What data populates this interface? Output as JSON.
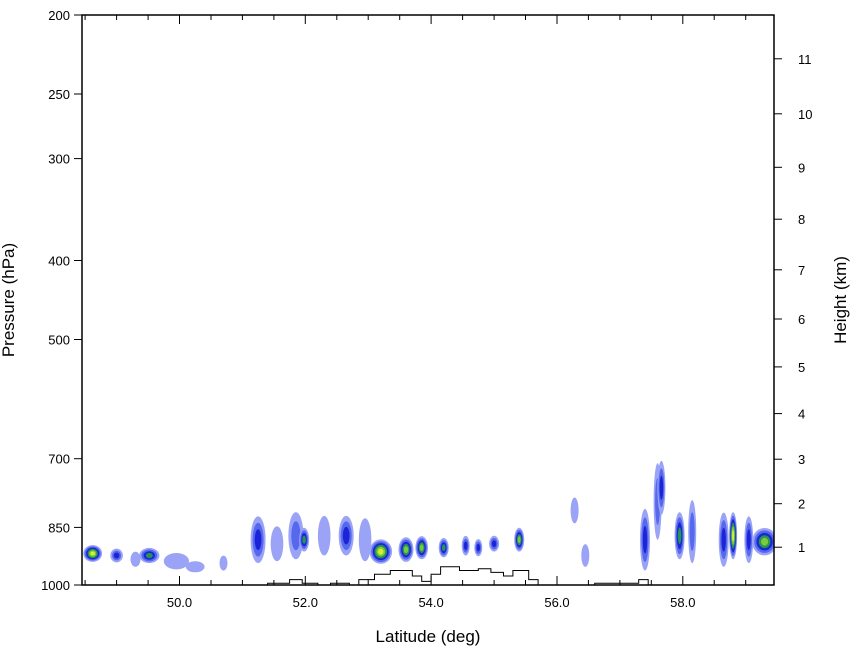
{
  "chart_data": {
    "type": "contour",
    "xlabel": "Latitude (deg)",
    "ylabel_left": "Pressure (hPa)",
    "ylabel_right": "Height (km)",
    "xlim": [
      48.45,
      59.45
    ],
    "x_ticks": [
      {
        "value": 50.0,
        "label": "50.0"
      },
      {
        "value": 52.0,
        "label": "52.0"
      },
      {
        "value": 54.0,
        "label": "54.0"
      },
      {
        "value": 56.0,
        "label": "56.0"
      },
      {
        "value": 58.0,
        "label": "58.0"
      }
    ],
    "pressure_range_hPa": [
      1000,
      200
    ],
    "pressure_ticks": [
      {
        "value": 200,
        "label": "200"
      },
      {
        "value": 250,
        "label": "250"
      },
      {
        "value": 300,
        "label": "300"
      },
      {
        "value": 400,
        "label": "400"
      },
      {
        "value": 500,
        "label": "500"
      },
      {
        "value": 700,
        "label": "700"
      },
      {
        "value": 850,
        "label": "850"
      },
      {
        "value": 1000,
        "label": "1000"
      }
    ],
    "height_ticks": [
      {
        "value": 1,
        "label": "1"
      },
      {
        "value": 2,
        "label": "2"
      },
      {
        "value": 3,
        "label": "3"
      },
      {
        "value": 4,
        "label": "4"
      },
      {
        "value": 5,
        "label": "5"
      },
      {
        "value": 6,
        "label": "6"
      },
      {
        "value": 7,
        "label": "7"
      },
      {
        "value": 8,
        "label": "8"
      },
      {
        "value": 9,
        "label": "9"
      },
      {
        "value": 10,
        "label": "10"
      },
      {
        "value": 11,
        "label": "11"
      }
    ],
    "fill_colors": [
      "#9aa3f5",
      "#5568ee",
      "#1c24d8",
      "#23964f",
      "#7cc93c",
      "#d7f02c"
    ],
    "cells": [
      {
        "lat": 48.62,
        "p": 915,
        "sx": 0.15,
        "sp": 22,
        "level": 6
      },
      {
        "lat": 49.0,
        "p": 920,
        "sx": 0.1,
        "sp": 18,
        "level": 3
      },
      {
        "lat": 49.3,
        "p": 930,
        "sx": 0.08,
        "sp": 20,
        "level": 1
      },
      {
        "lat": 49.52,
        "p": 920,
        "sx": 0.16,
        "sp": 20,
        "level": 4
      },
      {
        "lat": 49.95,
        "p": 935,
        "sx": 0.2,
        "sp": 22,
        "level": 1
      },
      {
        "lat": 50.25,
        "p": 950,
        "sx": 0.15,
        "sp": 15,
        "level": 1
      },
      {
        "lat": 50.7,
        "p": 940,
        "sx": 0.06,
        "sp": 20,
        "level": 1
      },
      {
        "lat": 51.25,
        "p": 880,
        "sx": 0.12,
        "sp": 60,
        "level": 3
      },
      {
        "lat": 51.55,
        "p": 890,
        "sx": 0.1,
        "sp": 45,
        "level": 1
      },
      {
        "lat": 51.85,
        "p": 870,
        "sx": 0.12,
        "sp": 60,
        "level": 2
      },
      {
        "lat": 51.98,
        "p": 880,
        "sx": 0.08,
        "sp": 30,
        "level": 4
      },
      {
        "lat": 52.3,
        "p": 870,
        "sx": 0.1,
        "sp": 50,
        "level": 1
      },
      {
        "lat": 52.65,
        "p": 870,
        "sx": 0.12,
        "sp": 50,
        "level": 3
      },
      {
        "lat": 52.95,
        "p": 880,
        "sx": 0.1,
        "sp": 55,
        "level": 1
      },
      {
        "lat": 53.2,
        "p": 910,
        "sx": 0.18,
        "sp": 32,
        "level": 6
      },
      {
        "lat": 53.6,
        "p": 905,
        "sx": 0.12,
        "sp": 32,
        "level": 5
      },
      {
        "lat": 53.85,
        "p": 900,
        "sx": 0.1,
        "sp": 30,
        "level": 5
      },
      {
        "lat": 54.2,
        "p": 900,
        "sx": 0.08,
        "sp": 25,
        "level": 4
      },
      {
        "lat": 54.55,
        "p": 895,
        "sx": 0.06,
        "sp": 25,
        "level": 3
      },
      {
        "lat": 54.75,
        "p": 900,
        "sx": 0.05,
        "sp": 22,
        "level": 3
      },
      {
        "lat": 55.0,
        "p": 890,
        "sx": 0.08,
        "sp": 20,
        "level": 3
      },
      {
        "lat": 55.4,
        "p": 880,
        "sx": 0.08,
        "sp": 30,
        "level": 5
      },
      {
        "lat": 56.28,
        "p": 810,
        "sx": 0.04,
        "sp": 30,
        "level": 1
      },
      {
        "lat": 56.45,
        "p": 920,
        "sx": 0.04,
        "sp": 30,
        "level": 1
      },
      {
        "lat": 57.4,
        "p": 880,
        "sx": 0.08,
        "sp": 80,
        "level": 3
      },
      {
        "lat": 57.6,
        "p": 790,
        "sx": 0.06,
        "sp": 90,
        "level": 2
      },
      {
        "lat": 57.66,
        "p": 760,
        "sx": 0.05,
        "sp": 60,
        "level": 3
      },
      {
        "lat": 57.95,
        "p": 870,
        "sx": 0.08,
        "sp": 60,
        "level": 4
      },
      {
        "lat": 58.15,
        "p": 860,
        "sx": 0.05,
        "sp": 80,
        "level": 2
      },
      {
        "lat": 58.65,
        "p": 880,
        "sx": 0.08,
        "sp": 70,
        "level": 3
      },
      {
        "lat": 58.8,
        "p": 870,
        "sx": 0.06,
        "sp": 60,
        "level": 6
      },
      {
        "lat": 59.05,
        "p": 880,
        "sx": 0.07,
        "sp": 60,
        "level": 3
      },
      {
        "lat": 59.3,
        "p": 885,
        "sx": 0.2,
        "sp": 35,
        "level": 5
      }
    ],
    "terrain_outline": [
      [
        48.45,
        1000
      ],
      [
        51.4,
        1000
      ],
      [
        51.4,
        995
      ],
      [
        51.75,
        995
      ],
      [
        51.75,
        985
      ],
      [
        51.95,
        985
      ],
      [
        51.95,
        995
      ],
      [
        52.2,
        995
      ],
      [
        52.2,
        1000
      ],
      [
        52.4,
        1000
      ],
      [
        52.4,
        995
      ],
      [
        52.7,
        995
      ],
      [
        52.7,
        1000
      ],
      [
        52.85,
        1000
      ],
      [
        52.85,
        985
      ],
      [
        53.1,
        985
      ],
      [
        53.1,
        970
      ],
      [
        53.35,
        970
      ],
      [
        53.35,
        960
      ],
      [
        53.7,
        960
      ],
      [
        53.7,
        975
      ],
      [
        53.85,
        975
      ],
      [
        53.85,
        990
      ],
      [
        54.0,
        990
      ],
      [
        54.0,
        970
      ],
      [
        54.15,
        970
      ],
      [
        54.15,
        950
      ],
      [
        54.45,
        950
      ],
      [
        54.45,
        960
      ],
      [
        54.75,
        960
      ],
      [
        54.75,
        955
      ],
      [
        54.95,
        955
      ],
      [
        54.95,
        965
      ],
      [
        55.15,
        965
      ],
      [
        55.15,
        975
      ],
      [
        55.3,
        975
      ],
      [
        55.3,
        960
      ],
      [
        55.55,
        960
      ],
      [
        55.55,
        985
      ],
      [
        55.7,
        985
      ],
      [
        55.7,
        1000
      ],
      [
        56.6,
        1000
      ],
      [
        56.6,
        995
      ],
      [
        57.3,
        995
      ],
      [
        57.3,
        985
      ],
      [
        57.45,
        985
      ],
      [
        57.45,
        1000
      ],
      [
        59.45,
        1000
      ]
    ]
  }
}
